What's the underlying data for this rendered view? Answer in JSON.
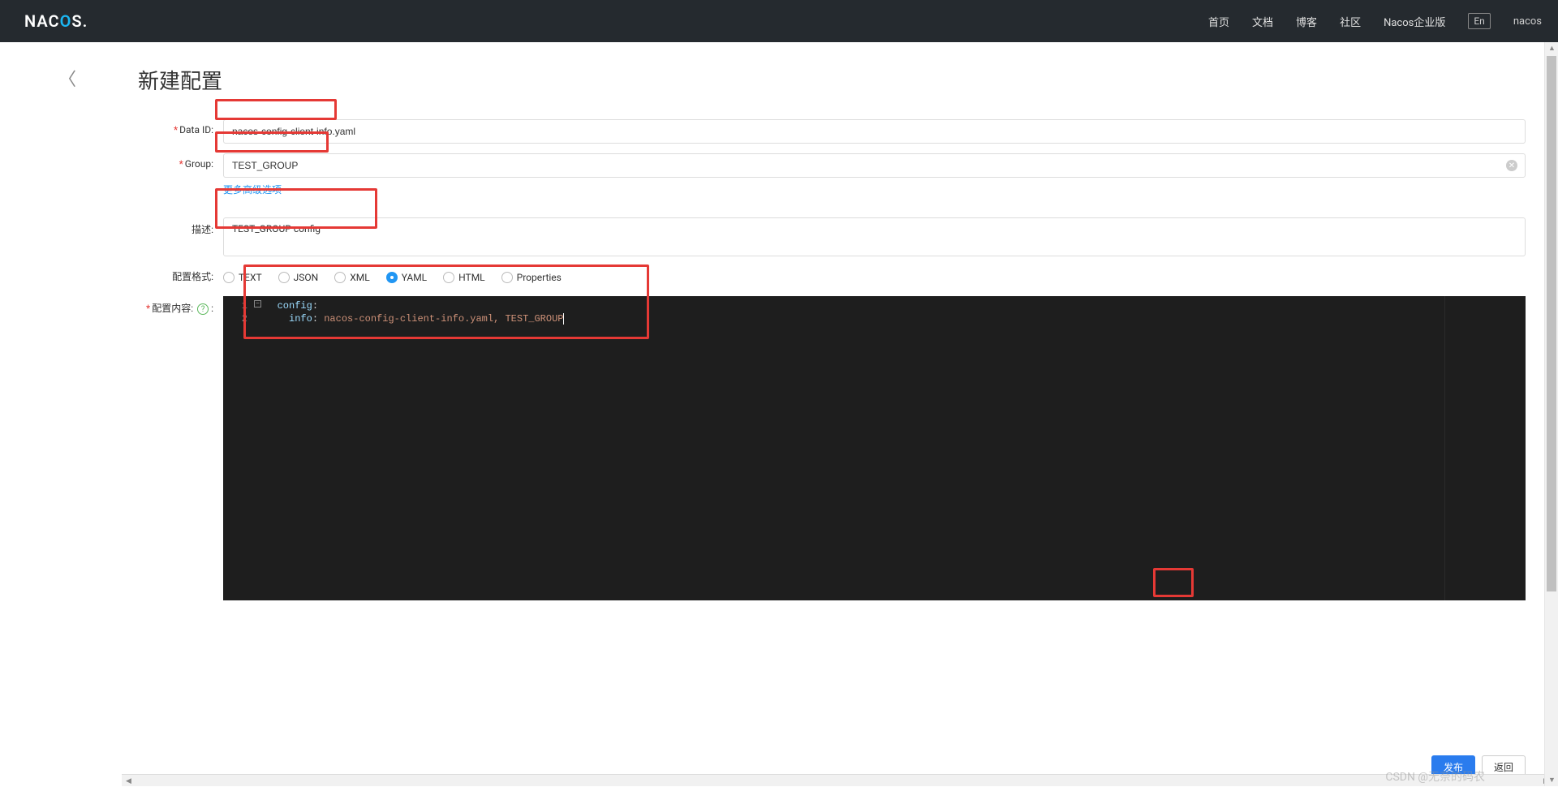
{
  "header": {
    "logo_prefix": "NAC",
    "logo_o": "O",
    "logo_suffix": "S.",
    "nav": {
      "home": "首页",
      "docs": "文档",
      "blog": "博客",
      "community": "社区",
      "enterprise": "Nacos企业版"
    },
    "lang": "En",
    "user": "nacos"
  },
  "page": {
    "title": "新建配置"
  },
  "form": {
    "dataId": {
      "label": "Data ID:",
      "value": "nacos-config-client-info.yaml"
    },
    "group": {
      "label": "Group:",
      "value": "TEST_GROUP"
    },
    "advanced": "更多高级选项",
    "description": {
      "label": "描述:",
      "value": "TEST_GROUP config"
    },
    "format": {
      "label": "配置格式:",
      "options": {
        "text": "TEXT",
        "json": "JSON",
        "xml": "XML",
        "yaml": "YAML",
        "html": "HTML",
        "properties": "Properties"
      },
      "selected": "yaml"
    },
    "content": {
      "label": "配置内容:",
      "code_line1_key": "config",
      "code_line2_key": "info",
      "code_line2_value": "nacos-config-client-info.yaml, TEST_GROUP",
      "line_nums": {
        "l1": "1",
        "l2": "2"
      }
    }
  },
  "buttons": {
    "publish": "发布",
    "back": "返回"
  },
  "watermark": "CSDN @无奈的码农"
}
